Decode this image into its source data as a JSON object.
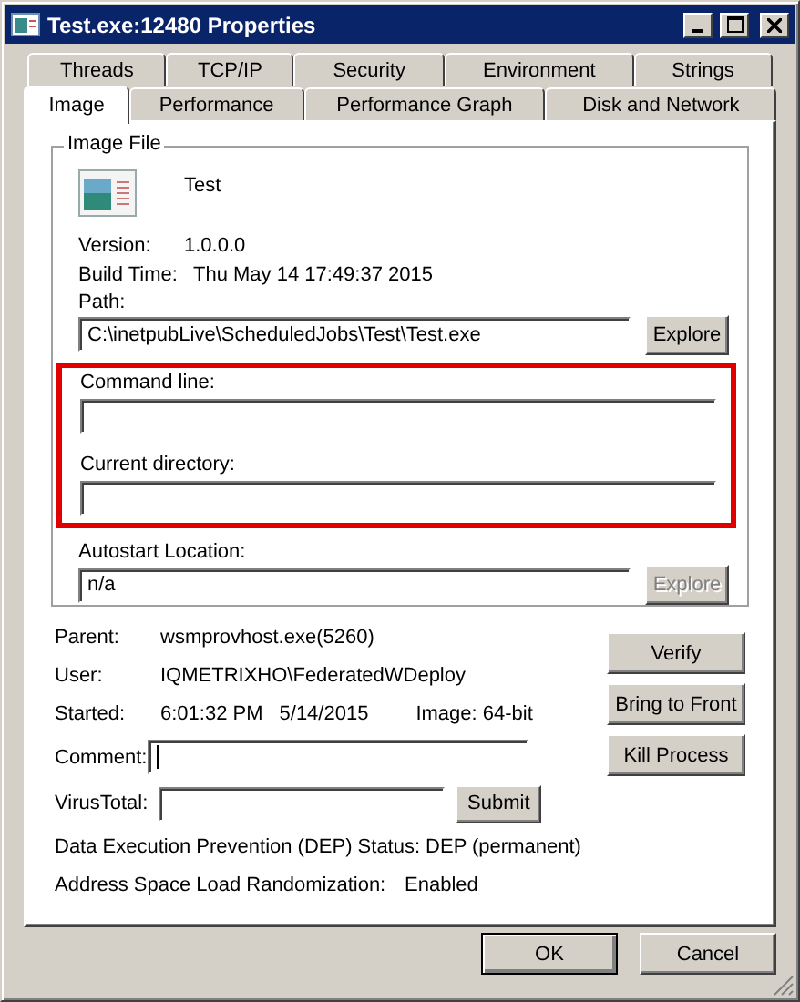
{
  "window": {
    "title": "Test.exe:12480 Properties"
  },
  "tab_rows": [
    [
      {
        "label": "Threads",
        "selected": false
      },
      {
        "label": "TCP/IP",
        "selected": false
      },
      {
        "label": "Security",
        "selected": false
      },
      {
        "label": "Environment",
        "selected": false
      },
      {
        "label": "Strings",
        "selected": false
      }
    ],
    [
      {
        "label": "Image",
        "selected": true
      },
      {
        "label": "Performance",
        "selected": false
      },
      {
        "label": "Performance Graph",
        "selected": false
      },
      {
        "label": "Disk and Network",
        "selected": false
      }
    ]
  ],
  "image_file": {
    "legend": "Image File",
    "name": "Test",
    "version_label": "Version:",
    "version": "1.0.0.0",
    "build_time_label": "Build Time:",
    "build_time": "Thu May 14 17:49:37 2015",
    "path_label": "Path:",
    "path": "C:\\inetpubLive\\ScheduledJobs\\Test\\Test.exe",
    "path_button": {
      "label": "Explore",
      "disabled": false
    },
    "highlighted": true,
    "command_line_label": "Command line:",
    "current_directory_label": "Current directory:",
    "autostart_label": "Autostart Location:",
    "autostart": "n/a",
    "autostart_button": {
      "label": "Explore",
      "disabled": true
    }
  },
  "details": [
    {
      "label": "Parent:",
      "value": "wsmprovhost.exe(5260)"
    },
    {
      "label": "User:",
      "value": "IQMETRIXHO\\FederatedWDeploy"
    }
  ],
  "started": {
    "label": "Started:",
    "time": "6:01:32 PM",
    "date": "5/14/2015",
    "image": "Image: 64-bit"
  },
  "comment": {
    "label": "Comment:",
    "focused": true
  },
  "virustotal": {
    "label": "VirusTotal:",
    "button": "Submit"
  },
  "side_buttons": [
    "Verify",
    "Bring to Front",
    "Kill Process"
  ],
  "dep": {
    "label": "Data Execution Prevention (DEP) Status:",
    "value": "DEP (permanent)"
  },
  "aslr": {
    "label": "Address Space Load Randomization:",
    "value": "Enabled"
  },
  "buttons": [
    {
      "label": "OK",
      "default": true
    },
    {
      "label": "Cancel",
      "default": false
    }
  ]
}
